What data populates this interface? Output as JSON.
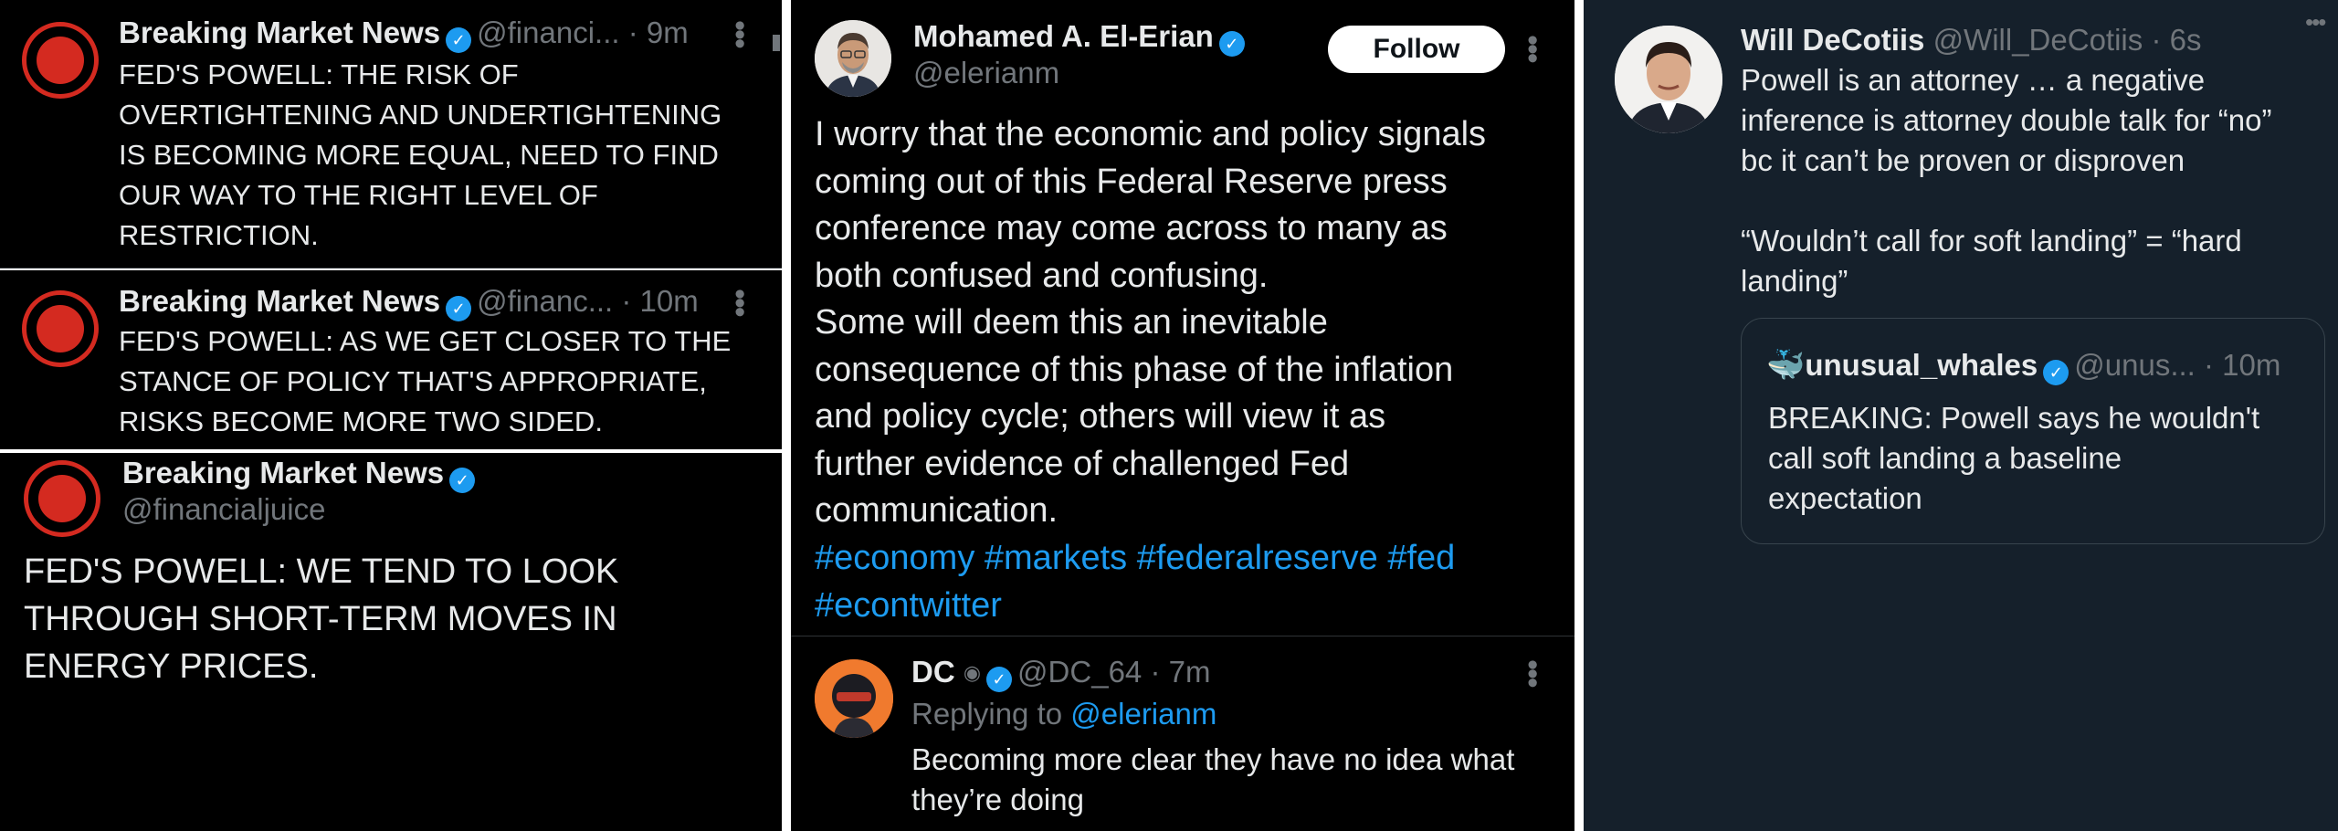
{
  "panel1": {
    "tweets": [
      {
        "name": "Breaking Market News",
        "handle": "@financi...",
        "time": "· 9m",
        "text": "FED'S POWELL: THE RISK OF\nOVERTIGHTENING AND UNDERTIGHTENING\nIS BECOMING MORE EQUAL, NEED TO FIND\nOUR WAY TO THE RIGHT LEVEL OF\nRESTRICTION."
      },
      {
        "name": "Breaking Market News",
        "handle": "@financ...",
        "time": "· 10m",
        "text": "FED'S POWELL: AS WE GET CLOSER TO THE\nSTANCE OF POLICY THAT'S APPROPRIATE,\nRISKS BECOME MORE TWO SIDED."
      },
      {
        "name": "Breaking Market News",
        "handle": "@financialjuice",
        "text": "FED'S POWELL: WE TEND TO LOOK\nTHROUGH SHORT-TERM MOVES IN\nENERGY PRICES."
      }
    ]
  },
  "panel2": {
    "main": {
      "name": "Mohamed A. El-Erian",
      "handle": "@elerianm",
      "follow_label": "Follow",
      "text": "I worry that the economic and policy signals\ncoming out of this Federal Reserve press\nconference may come across to many as\nboth confused and confusing.\nSome will deem this an inevitable\nconsequence of this phase of the inflation\nand policy cycle; others will view it as\nfurther evidence of challenged Fed\ncommunication.",
      "hashtags": [
        "#economy",
        "#markets",
        "#federalreserve",
        "#fed",
        "#econtwitter"
      ]
    },
    "reply": {
      "name": "DC",
      "handle": "@DC_64",
      "time": "· 7m",
      "replying_prefix": "Replying to",
      "replying_to": "@elerianm",
      "text": "Becoming more clear they have no idea what\nthey’re doing"
    }
  },
  "panel3": {
    "main": {
      "name": "Will DeCotiis",
      "handle": "@Will_DeCotiis",
      "time": "· 6s",
      "text": "Powell is an attorney … a negative\ninference is attorney double talk for “no”\nbc it can’t be proven or disproven\n\n“Wouldn’t call for soft landing” = “hard\nlanding”"
    },
    "quote": {
      "name": "unusual_whales",
      "handle": "@unus...",
      "time": "· 10m",
      "text": "BREAKING: Powell says he wouldn't\ncall soft landing a baseline\nexpectation"
    }
  },
  "colors": {
    "accent": "#1d9bf0",
    "avatar_red": "#d42a20",
    "dim_bg": "#15202b",
    "black_bg": "#000000"
  }
}
